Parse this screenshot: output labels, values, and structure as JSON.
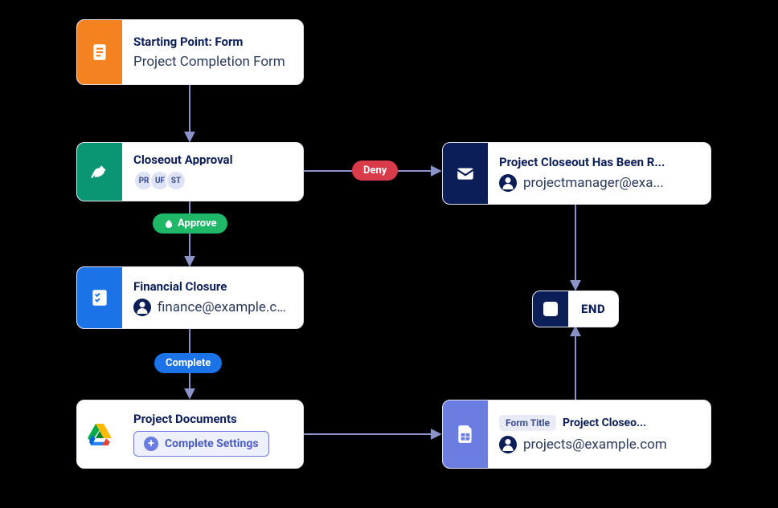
{
  "nodes": {
    "start": {
      "title": "Starting Point: Form",
      "subtitle": "Project Completion Form"
    },
    "approval": {
      "title": "Closeout Approval",
      "chips": [
        "PR",
        "UF",
        "ST"
      ]
    },
    "rejection": {
      "title": "Project Closeout Has Been R...",
      "assignee": "projectmanager@exa..."
    },
    "financial": {
      "title": "Financial Closure",
      "assignee": "finance@example.com"
    },
    "documents": {
      "title": "Project Documents",
      "settings_btn": "Complete Settings"
    },
    "sheet": {
      "tag": "Form Title",
      "tag_value": "Project Closeo...",
      "assignee": "projects@example.com"
    },
    "end_label": "END"
  },
  "connectors": {
    "approve": "Approve",
    "deny": "Deny",
    "complete": "Complete"
  }
}
